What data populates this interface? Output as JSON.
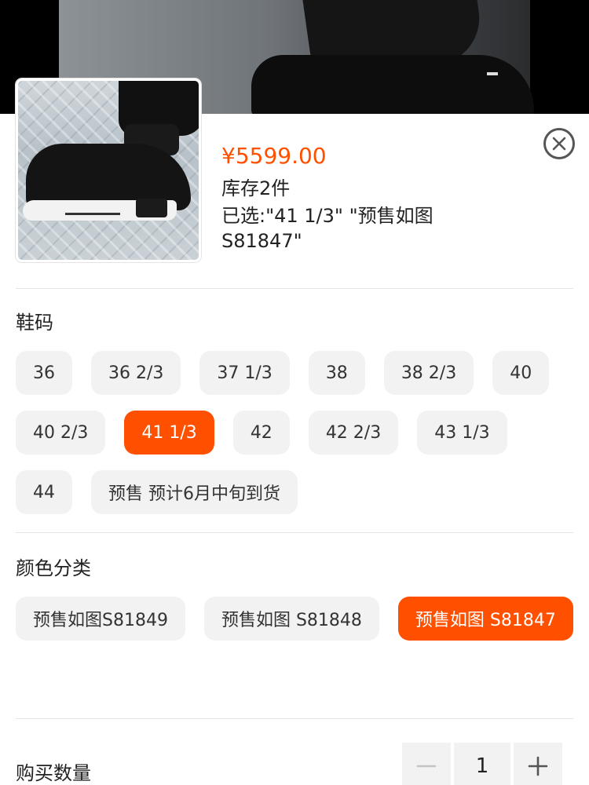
{
  "product": {
    "price": "¥5599.00",
    "stock": "库存2件",
    "selected": "已选:\"41 1/3\" \"预售如图S81847\""
  },
  "size": {
    "title": "鞋码",
    "options": [
      "36",
      "36 2/3",
      "37 1/3",
      "38",
      "38 2/3",
      "40",
      "40 2/3",
      "41 1/3",
      "42",
      "42 2/3",
      "43 1/3",
      "44",
      "预售 预计6月中旬到货"
    ],
    "selected": "41 1/3"
  },
  "color": {
    "title": "颜色分类",
    "options": [
      "预售如图S81849",
      "预售如图 S81848",
      "预售如图 S81847"
    ],
    "selected": "预售如图 S81847"
  },
  "quantity": {
    "label": "购买数量",
    "value": "1"
  },
  "icons": {
    "close": "close-icon",
    "minus": "minus-icon",
    "plus": "plus-icon"
  },
  "colors": {
    "accent": "#ff5000",
    "chip_bg": "#f2f2f2"
  }
}
